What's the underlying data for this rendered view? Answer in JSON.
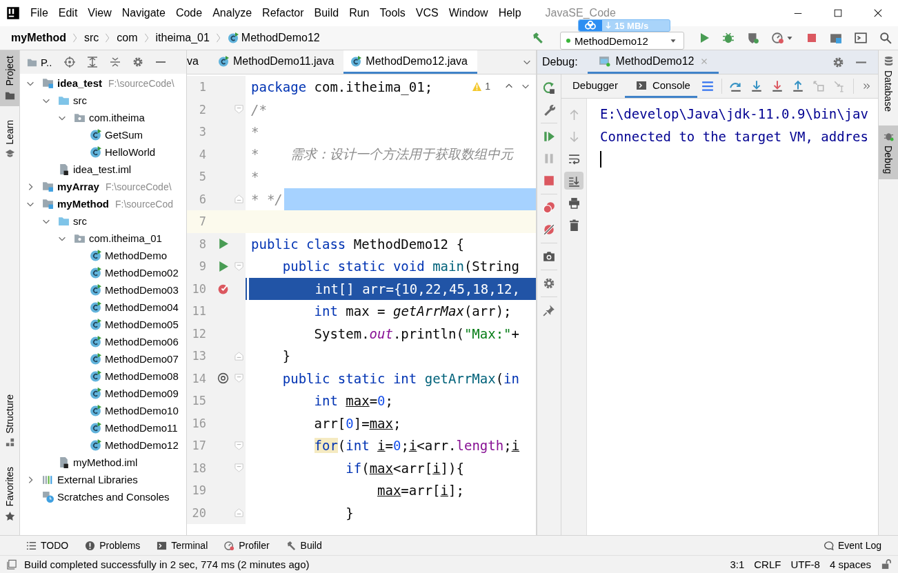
{
  "window": {
    "title": "JavaSE_Code",
    "menu": [
      "File",
      "Edit",
      "View",
      "Navigate",
      "Code",
      "Analyze",
      "Refactor",
      "Build",
      "Run",
      "Tools",
      "VCS",
      "Window",
      "Help"
    ]
  },
  "network_overlay": {
    "speed": "15 MB/s"
  },
  "navigation_bar": {
    "breadcrumbs": [
      {
        "label": "myMethod",
        "kind": "project"
      },
      {
        "label": "src",
        "kind": "folder"
      },
      {
        "label": "com",
        "kind": "folder"
      },
      {
        "label": "itheima_01",
        "kind": "folder"
      },
      {
        "label": "MethodDemo12",
        "kind": "class"
      }
    ],
    "run_configuration": "MethodDemo12"
  },
  "left_stripe": [
    {
      "label": "Project",
      "kind": "project",
      "selected": true
    },
    {
      "label": "Learn",
      "kind": "learn",
      "selected": false
    },
    {
      "label": "Structure",
      "kind": "structure",
      "selected": false
    },
    {
      "label": "Favorites",
      "kind": "favorites",
      "selected": false
    }
  ],
  "project_panel": {
    "view": "P..",
    "tree": [
      {
        "label": "idea_test",
        "kind": "module",
        "hint": "F:\\sourceCode\\",
        "expanded": true,
        "children": [
          {
            "label": "src",
            "kind": "folder",
            "expanded": true,
            "children": [
              {
                "label": "com.itheima",
                "kind": "package",
                "expanded": true,
                "children": [
                  {
                    "label": "GetSum",
                    "kind": "class"
                  },
                  {
                    "label": "HelloWorld",
                    "kind": "class"
                  }
                ]
              }
            ]
          },
          {
            "label": "idea_test.iml",
            "kind": "file"
          }
        ]
      },
      {
        "label": "myArray",
        "kind": "module",
        "hint": "F:\\sourceCode\\",
        "expanded": false
      },
      {
        "label": "myMethod",
        "kind": "module",
        "hint": "F:\\sourceCod",
        "expanded": true,
        "children": [
          {
            "label": "src",
            "kind": "folder",
            "expanded": true,
            "children": [
              {
                "label": "com.itheima_01",
                "kind": "package",
                "expanded": true,
                "children": [
                  {
                    "label": "MethodDemo",
                    "kind": "class"
                  },
                  {
                    "label": "MethodDemo02",
                    "kind": "class"
                  },
                  {
                    "label": "MethodDemo03",
                    "kind": "class"
                  },
                  {
                    "label": "MethodDemo04",
                    "kind": "class"
                  },
                  {
                    "label": "MethodDemo05",
                    "kind": "class"
                  },
                  {
                    "label": "MethodDemo06",
                    "kind": "class"
                  },
                  {
                    "label": "MethodDemo07",
                    "kind": "class"
                  },
                  {
                    "label": "MethodDemo08",
                    "kind": "class"
                  },
                  {
                    "label": "MethodDemo09",
                    "kind": "class"
                  },
                  {
                    "label": "MethodDemo10",
                    "kind": "class"
                  },
                  {
                    "label": "MethodDemo11",
                    "kind": "class"
                  },
                  {
                    "label": "MethodDemo12",
                    "kind": "class"
                  }
                ]
              }
            ]
          },
          {
            "label": "myMethod.iml",
            "kind": "file"
          }
        ]
      },
      {
        "label": "External Libraries",
        "kind": "libraries",
        "expanded": false
      },
      {
        "label": "Scratches and Consoles",
        "kind": "scratches"
      }
    ]
  },
  "editor": {
    "tabs": [
      {
        "label": "va",
        "selected": false
      },
      {
        "label": "MethodDemo11.java",
        "selected": false
      },
      {
        "label": "MethodDemo12.java",
        "selected": true
      }
    ],
    "warnings": "1",
    "lines": [
      {
        "number": "1",
        "tokens": [
          {
            "kind": "kw",
            "text": "package"
          },
          {
            "kind": "plain",
            "text": " com.itheima_01;"
          }
        ]
      },
      {
        "number": "2",
        "fold": {
          "kind": "start"
        },
        "tokens": [
          {
            "kind": "comment",
            "text": "/*"
          }
        ]
      },
      {
        "number": "3",
        "tokens": [
          {
            "kind": "comment",
            "text": "*"
          }
        ]
      },
      {
        "number": "4",
        "tokens": [
          {
            "kind": "comment",
            "text": "*    需求：设计一个方法用于获取数组中元"
          }
        ]
      },
      {
        "number": "5",
        "tokens": [
          {
            "kind": "comment",
            "text": "*"
          }
        ]
      },
      {
        "number": "6",
        "fold": {
          "kind": "end"
        },
        "highlight": {
          "kind": "selection"
        },
        "tokens": [
          {
            "kind": "comment",
            "text": "* */"
          }
        ]
      },
      {
        "number": "7",
        "highlight": {
          "kind": "caret"
        }
      },
      {
        "number": "8",
        "gutter_mark": {
          "kind": "run"
        },
        "tokens": [
          {
            "kind": "kw",
            "text": "public class"
          },
          {
            "kind": "plain",
            "text": " MethodDemo12 {"
          }
        ]
      },
      {
        "number": "9",
        "gutter_mark": {
          "kind": "run"
        },
        "fold": {
          "kind": "start"
        },
        "tokens": [
          {
            "kind": "kw",
            "text": "    public static void"
          },
          {
            "kind": "method",
            "text": " main"
          },
          {
            "kind": "plain",
            "text": "(String"
          }
        ]
      },
      {
        "number": "10",
        "gutter_mark": {
          "kind": "breakpoint"
        },
        "highlight": {
          "kind": "execution"
        },
        "tokens": [
          {
            "kind": "kw",
            "text": "        int"
          },
          {
            "kind": "plain",
            "text": "[] arr={10,22,45,18,12,"
          }
        ]
      },
      {
        "number": "11",
        "tokens": [
          {
            "kind": "kw",
            "text": "        int"
          },
          {
            "kind": "plain",
            "text": " max = "
          },
          {
            "kind": "call",
            "text": "getArrMax"
          },
          {
            "kind": "plain",
            "text": "(arr);"
          }
        ]
      },
      {
        "number": "12",
        "tokens": [
          {
            "kind": "plain",
            "text": "        System."
          },
          {
            "kind": "static",
            "text": "out"
          },
          {
            "kind": "plain",
            "text": ".println("
          },
          {
            "kind": "str",
            "text": "\"Max:\""
          },
          {
            "kind": "plain",
            "text": "+"
          }
        ]
      },
      {
        "number": "13",
        "fold": {
          "kind": "end"
        },
        "tokens": [
          {
            "kind": "plain",
            "text": "    }"
          }
        ]
      },
      {
        "number": "14",
        "gutter_mark": {
          "kind": "override"
        },
        "fold": {
          "kind": "start"
        },
        "tokens": [
          {
            "kind": "kw",
            "text": "    public static int"
          },
          {
            "kind": "method",
            "text": " getArrMax"
          },
          {
            "kind": "plain",
            "text": "("
          },
          {
            "kind": "kw",
            "text": "in"
          }
        ]
      },
      {
        "number": "15",
        "tokens": [
          {
            "kind": "kw",
            "text": "        int"
          },
          {
            "kind": "var",
            "text": " max"
          },
          {
            "kind": "plain",
            "text": "="
          },
          {
            "kind": "num",
            "text": "0"
          },
          {
            "kind": "plain",
            "text": ";"
          }
        ]
      },
      {
        "number": "16",
        "tokens": [
          {
            "kind": "plain",
            "text": "        arr["
          },
          {
            "kind": "num",
            "text": "0"
          },
          {
            "kind": "plain",
            "text": "]="
          },
          {
            "kind": "var",
            "text": "max"
          },
          {
            "kind": "plain",
            "text": ";"
          }
        ]
      },
      {
        "number": "17",
        "fold": {
          "kind": "start"
        },
        "tokens": [
          {
            "kind": "kw_marked",
            "text": "        for"
          },
          {
            "kind": "plain",
            "text": "("
          },
          {
            "kind": "kw",
            "text": "int"
          },
          {
            "kind": "var",
            "text": " i"
          },
          {
            "kind": "plain",
            "text": "="
          },
          {
            "kind": "num",
            "text": "0"
          },
          {
            "kind": "plain",
            "text": ";"
          },
          {
            "kind": "var",
            "text": "i"
          },
          {
            "kind": "plain",
            "text": "<arr."
          },
          {
            "kind": "member",
            "text": "length"
          },
          {
            "kind": "plain",
            "text": ";"
          },
          {
            "kind": "var",
            "text": "i"
          }
        ]
      },
      {
        "number": "18",
        "fold": {
          "kind": "start"
        },
        "tokens": [
          {
            "kind": "kw",
            "text": "            if"
          },
          {
            "kind": "plain",
            "text": "("
          },
          {
            "kind": "var",
            "text": "max"
          },
          {
            "kind": "plain",
            "text": "<arr["
          },
          {
            "kind": "var",
            "text": "i"
          },
          {
            "kind": "plain",
            "text": "]){"
          }
        ]
      },
      {
        "number": "19",
        "tokens": [
          {
            "kind": "var",
            "text": "                max"
          },
          {
            "kind": "plain",
            "text": "=arr["
          },
          {
            "kind": "var",
            "text": "i"
          },
          {
            "kind": "plain",
            "text": "];"
          }
        ]
      },
      {
        "number": "20",
        "fold": {
          "kind": "end"
        },
        "tokens": [
          {
            "kind": "plain",
            "text": "            }"
          }
        ]
      }
    ]
  },
  "debug": {
    "label": "Debug:",
    "session": "MethodDemo12",
    "tabs": [
      {
        "label": "Debugger",
        "kind": "plain",
        "selected": false
      },
      {
        "label": "Console",
        "kind": "console",
        "selected": true
      }
    ],
    "actions": [
      {
        "kind": "rerun",
        "disabled": false
      },
      {
        "kind": "wrench",
        "disabled": false
      },
      {
        "kind": "resume",
        "disabled": false
      },
      {
        "kind": "pause",
        "disabled": true
      },
      {
        "kind": "stop",
        "disabled": false
      },
      {
        "kind": "breakpoints",
        "disabled": false
      },
      {
        "kind": "mute",
        "disabled": false
      },
      {
        "kind": "camera",
        "disabled": false
      },
      {
        "kind": "gear",
        "disabled": false
      },
      {
        "kind": "pin",
        "disabled": false
      }
    ],
    "stepping": [
      {
        "kind": "step-over",
        "disabled": false
      },
      {
        "kind": "step-into",
        "disabled": false
      },
      {
        "kind": "force-step-into",
        "disabled": false
      },
      {
        "kind": "step-out",
        "disabled": false
      },
      {
        "kind": "drop-frame",
        "disabled": true
      },
      {
        "kind": "run-to-cursor",
        "disabled": true
      }
    ],
    "console_tools": [
      {
        "kind": "up",
        "disabled": true,
        "selected": false
      },
      {
        "kind": "down",
        "disabled": true,
        "selected": false
      },
      {
        "kind": "soft-wrap",
        "disabled": false,
        "selected": false
      },
      {
        "kind": "scroll-end",
        "disabled": false,
        "selected": true
      },
      {
        "kind": "print",
        "disabled": false,
        "selected": false
      },
      {
        "kind": "trash",
        "disabled": false,
        "selected": false
      }
    ],
    "console_lines": [
      "E:\\develop\\Java\\jdk-11.0.9\\bin\\jav",
      "Connected to the target VM, addres"
    ]
  },
  "right_stripe": [
    {
      "label": "Database",
      "kind": "database",
      "selected": false
    },
    {
      "label": "Debug",
      "kind": "bug",
      "selected": true
    }
  ],
  "bottom_tools": [
    {
      "label": "TODO",
      "kind": "todo"
    },
    {
      "label": "Problems",
      "kind": "problems"
    },
    {
      "label": "Terminal",
      "kind": "terminal"
    },
    {
      "label": "Profiler",
      "kind": "profiler"
    },
    {
      "label": "Build",
      "kind": "hammer"
    }
  ],
  "event_log": "Event Log",
  "status_bar": {
    "message": "Build completed successfully in 2 sec, 774 ms (2 minutes ago)",
    "items": [
      "3:1",
      "CRLF",
      "UTF-8",
      "4 spaces"
    ]
  }
}
